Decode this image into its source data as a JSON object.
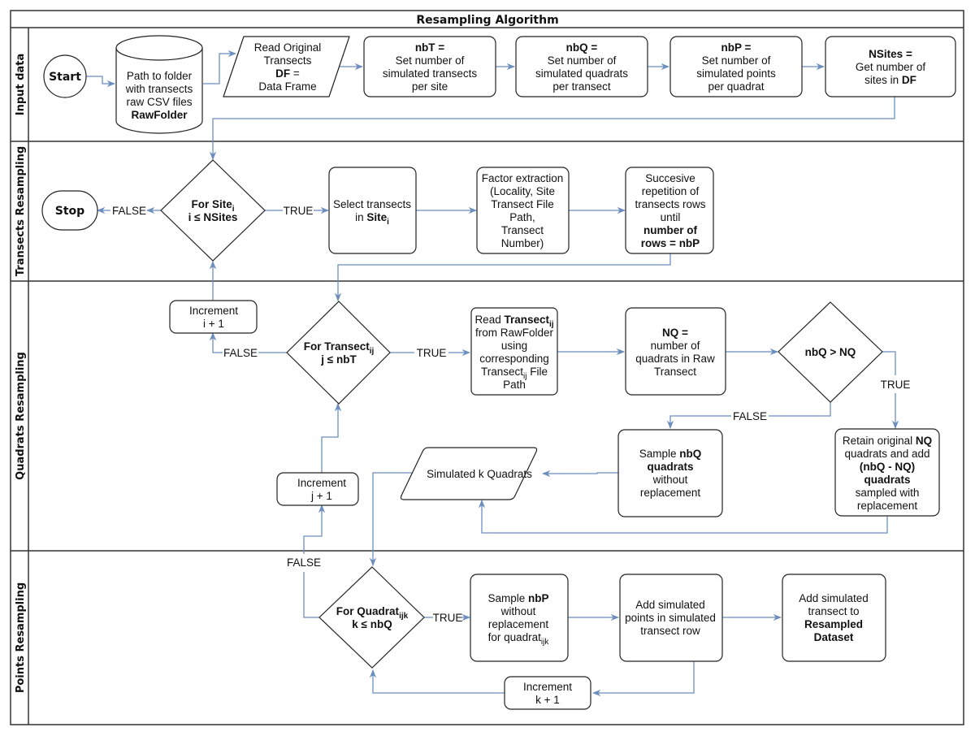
{
  "title": "Resampling Algorithm",
  "lanes": [
    {
      "id": "input",
      "label": "Input data"
    },
    {
      "id": "transects",
      "label": "Transects Resampling"
    },
    {
      "id": "quadrats",
      "label": "Quadrats Resampling"
    },
    {
      "id": "points",
      "label": "Points Resampling"
    }
  ],
  "colors": {
    "edge": "#6c8ebf",
    "border": "#222222"
  },
  "nodes": {
    "start": {
      "type": "terminal",
      "lines": [
        [
          {
            "t": "Start",
            "b": true
          }
        ]
      ]
    },
    "rawfolder": {
      "type": "database",
      "lines": [
        [
          {
            "t": "Path to folder"
          }
        ],
        [
          {
            "t": "with transects"
          }
        ],
        [
          {
            "t": "raw CSV files"
          }
        ],
        [
          {
            "t": "RawFolder",
            "b": true
          }
        ]
      ]
    },
    "read_df": {
      "type": "data",
      "lines": [
        [
          {
            "t": "Read Original"
          }
        ],
        [
          {
            "t": "Transects"
          }
        ],
        [
          {
            "t": "DF",
            "b": true
          },
          {
            "t": " ="
          }
        ],
        [
          {
            "t": "Data Frame"
          }
        ]
      ]
    },
    "nbT": {
      "type": "process",
      "lines": [
        [
          {
            "t": "nbT =",
            "b": true
          }
        ],
        [
          {
            "t": "Set number of"
          }
        ],
        [
          {
            "t": "simulated transects"
          }
        ],
        [
          {
            "t": "per site"
          }
        ]
      ]
    },
    "nbQ": {
      "type": "process",
      "lines": [
        [
          {
            "t": "nbQ =",
            "b": true
          }
        ],
        [
          {
            "t": "Set number of"
          }
        ],
        [
          {
            "t": "simulated quadrats"
          }
        ],
        [
          {
            "t": "per transect"
          }
        ]
      ]
    },
    "nbP": {
      "type": "process",
      "lines": [
        [
          {
            "t": "nbP =",
            "b": true
          }
        ],
        [
          {
            "t": "Set number of"
          }
        ],
        [
          {
            "t": "simulated points"
          }
        ],
        [
          {
            "t": "per quadrat"
          }
        ]
      ]
    },
    "nsites": {
      "type": "process",
      "lines": [
        [
          {
            "t": "NSites =",
            "b": true
          }
        ],
        [
          {
            "t": "Get number of"
          }
        ],
        [
          {
            "t": "sites in "
          },
          {
            "t": "DF",
            "b": true
          }
        ]
      ]
    },
    "stop": {
      "type": "terminal",
      "lines": [
        [
          {
            "t": "Stop",
            "b": true
          }
        ]
      ]
    },
    "for_site": {
      "type": "decision",
      "lines": [
        [
          {
            "t": "For Site",
            "b": true
          },
          {
            "t": "i",
            "b": true,
            "sub": true
          }
        ],
        [
          {
            "t": "i ≤ NSites",
            "b": true
          }
        ]
      ]
    },
    "select_transects": {
      "type": "process",
      "lines": [
        [
          {
            "t": "Select transects"
          }
        ],
        [
          {
            "t": "in  "
          },
          {
            "t": "Site",
            "b": true
          },
          {
            "t": "i",
            "b": true,
            "sub": true
          }
        ]
      ]
    },
    "factor_extraction": {
      "type": "process",
      "lines": [
        [
          {
            "t": "Factor extraction"
          }
        ],
        [
          {
            "t": "(Locality, Site"
          }
        ],
        [
          {
            "t": "Transect File"
          }
        ],
        [
          {
            "t": "Path,"
          }
        ],
        [
          {
            "t": "Transect"
          }
        ],
        [
          {
            "t": "Number)"
          }
        ]
      ]
    },
    "repetition": {
      "type": "process",
      "lines": [
        [
          {
            "t": "Succesive"
          }
        ],
        [
          {
            "t": "repetition of"
          }
        ],
        [
          {
            "t": "transects rows"
          }
        ],
        [
          {
            "t": "until"
          }
        ],
        [
          {
            "t": "number of",
            "b": true
          }
        ],
        [
          {
            "t": "rows = nbP",
            "b": true
          }
        ]
      ]
    },
    "inc_i": {
      "type": "process",
      "lines": [
        [
          {
            "t": "Increment"
          }
        ],
        [
          {
            "t": "i + 1"
          }
        ]
      ]
    },
    "for_transect": {
      "type": "decision",
      "lines": [
        [
          {
            "t": "For Transect",
            "b": true
          },
          {
            "t": "ij",
            "b": true,
            "sub": true
          }
        ],
        [
          {
            "t": "j ≤ nbT",
            "b": true
          }
        ]
      ]
    },
    "read_transect": {
      "type": "process",
      "lines": [
        [
          {
            "t": "Read "
          },
          {
            "t": "Transect",
            "b": true
          },
          {
            "t": "ij",
            "b": true,
            "sub": true
          }
        ],
        [
          {
            "t": "from RawFolder"
          }
        ],
        [
          {
            "t": "using"
          }
        ],
        [
          {
            "t": "corresponding"
          }
        ],
        [
          {
            "t": "Transect"
          },
          {
            "t": "ij",
            "sub": true
          },
          {
            "t": " File"
          }
        ],
        [
          {
            "t": "Path"
          }
        ]
      ]
    },
    "nq": {
      "type": "process",
      "lines": [
        [
          {
            "t": "NQ =",
            "b": true
          }
        ],
        [
          {
            "t": "number of"
          }
        ],
        [
          {
            "t": "quadrats in Raw"
          }
        ],
        [
          {
            "t": "Transect"
          }
        ]
      ]
    },
    "nbq_gt_nq": {
      "type": "decision",
      "lines": [
        [
          {
            "t": "nbQ > NQ",
            "b": true
          }
        ]
      ]
    },
    "sample_nbq": {
      "type": "process",
      "lines": [
        [
          {
            "t": "Sample "
          },
          {
            "t": "nbQ",
            "b": true
          }
        ],
        [
          {
            "t": "quadrats",
            "b": true
          }
        ],
        [
          {
            "t": "without"
          }
        ],
        [
          {
            "t": "replacement"
          }
        ]
      ]
    },
    "retain_nq": {
      "type": "process",
      "lines": [
        [
          {
            "t": "Retain original "
          },
          {
            "t": "NQ",
            "b": true
          }
        ],
        [
          {
            "t": "quadrats and add"
          }
        ],
        [
          {
            "t": "(nbQ - NQ)",
            "b": true
          }
        ],
        [
          {
            "t": "quadrats",
            "b": true
          }
        ],
        [
          {
            "t": "sampled with"
          }
        ],
        [
          {
            "t": "replacement"
          }
        ]
      ]
    },
    "sim_quadrats": {
      "type": "data",
      "lines": [
        [
          {
            "t": "Simulated k Quadrats"
          }
        ]
      ]
    },
    "inc_j": {
      "type": "process",
      "lines": [
        [
          {
            "t": "Increment"
          }
        ],
        [
          {
            "t": "j + 1"
          }
        ]
      ]
    },
    "for_quadrat": {
      "type": "decision",
      "lines": [
        [
          {
            "t": "For Quadrat",
            "b": true
          },
          {
            "t": "ijk",
            "b": true,
            "sub": true
          }
        ],
        [
          {
            "t": "k ≤ nbQ",
            "b": true
          }
        ]
      ]
    },
    "sample_nbp": {
      "type": "process",
      "lines": [
        [
          {
            "t": "Sample "
          },
          {
            "t": "nbP",
            "b": true
          }
        ],
        [
          {
            "t": "without"
          }
        ],
        [
          {
            "t": "replacement"
          }
        ],
        [
          {
            "t": "for quadrat"
          },
          {
            "t": "ijk",
            "sub": true
          }
        ]
      ]
    },
    "add_points": {
      "type": "process",
      "lines": [
        [
          {
            "t": "Add simulated"
          }
        ],
        [
          {
            "t": "points in simulated"
          }
        ],
        [
          {
            "t": "transect row"
          }
        ]
      ]
    },
    "add_transect": {
      "type": "process",
      "lines": [
        [
          {
            "t": "Add simulated"
          }
        ],
        [
          {
            "t": "transect to"
          }
        ],
        [
          {
            "t": "Resampled",
            "b": true
          }
        ],
        [
          {
            "t": "Dataset",
            "b": true
          }
        ]
      ]
    },
    "inc_k": {
      "type": "process",
      "lines": [
        [
          {
            "t": "Increment"
          }
        ],
        [
          {
            "t": "k + 1"
          }
        ]
      ]
    }
  },
  "edge_labels": {
    "site_false": "FALSE",
    "site_true": "TRUE",
    "transect_false": "FALSE",
    "transect_true": "TRUE",
    "nbq_false": "FALSE",
    "nbq_true": "TRUE",
    "quadrat_false": "FALSE",
    "quadrat_true": "TRUE"
  }
}
